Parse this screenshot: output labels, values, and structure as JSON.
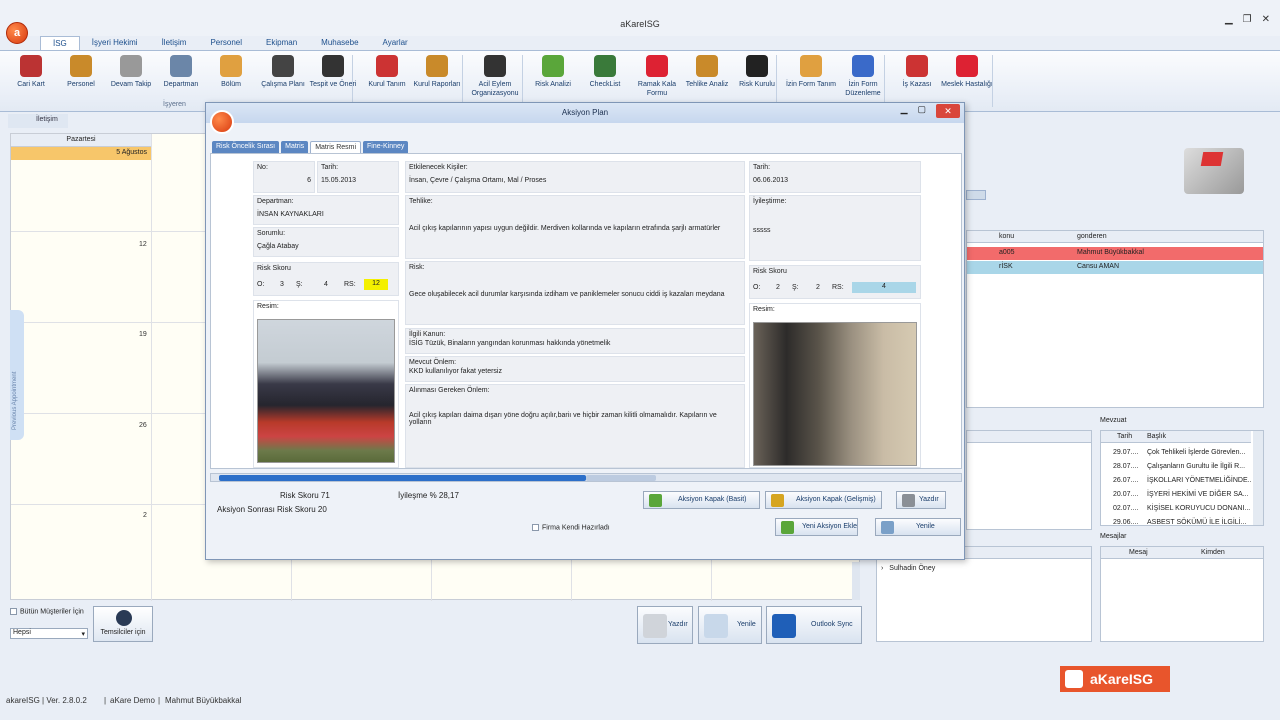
{
  "app": {
    "title": "aKareISG"
  },
  "ribbon": {
    "tabs": [
      "İSG",
      "İşyeri Hekimi",
      "İletişim",
      "Personel",
      "Ekipman",
      "Muhasebe",
      "Ayarlar"
    ],
    "buttons": [
      {
        "label": "Cari Kart",
        "icon": "person-icon",
        "color": "#b33"
      },
      {
        "label": "Personel",
        "icon": "person-icon",
        "color": "#c98a2a"
      },
      {
        "label": "Devam Takip",
        "icon": "clock-icon",
        "color": "#999"
      },
      {
        "label": "Departman",
        "icon": "building-icon",
        "color": "#6b86a8"
      },
      {
        "label": "Bölüm",
        "icon": "list-icon",
        "color": "#e0a040"
      },
      {
        "label": "Çalışma Planı",
        "icon": "clock-icon",
        "color": "#444"
      },
      {
        "label": "Tespit ve Öneri",
        "icon": "pen-icon",
        "color": "#333"
      },
      {
        "label": "Kurul Tanım",
        "icon": "org-chart-icon",
        "color": "#c33"
      },
      {
        "label": "Kurul Raporları",
        "icon": "report-icon",
        "color": "#c98a2a"
      },
      {
        "label": "Acil Eylem Organizasyonu",
        "icon": "people-icon",
        "color": "#333"
      },
      {
        "label": "Risk Analizi",
        "icon": "shield-icon",
        "color": "#5aa63a"
      },
      {
        "label": "CheckList",
        "icon": "checklist-icon",
        "color": "#3a7a3a"
      },
      {
        "label": "Ramak Kala Formu",
        "icon": "stop-icon",
        "color": "#d23"
      },
      {
        "label": "Tehlike Analiz",
        "icon": "document-icon",
        "color": "#c98a2a"
      },
      {
        "label": "Risk Kurulu",
        "icon": "people-icon",
        "color": "#222"
      },
      {
        "label": "İzin Form Tanım",
        "icon": "form-icon",
        "color": "#e0a040"
      },
      {
        "label": "İzin Form Düzenleme",
        "icon": "person-icon",
        "color": "#3a6ac9"
      },
      {
        "label": "İş Kazası",
        "icon": "accident-icon",
        "color": "#c33"
      },
      {
        "label": "Meslek Hastalığı",
        "icon": "heart-icon",
        "color": "#d23"
      }
    ],
    "group_label": "İşyeren"
  },
  "calendar": {
    "tab_label": "İletişim",
    "day_header": "Pazartesi",
    "first_day": "5 Ağustos",
    "week_numbers": [
      "12",
      "19",
      "26",
      "2"
    ],
    "prev_appointment": "Previous Appointment"
  },
  "left_bottom": {
    "all_customers": "Bütün Müşteriler İçin",
    "filter_value": "Hepsi",
    "representatives": "Temsilciler için"
  },
  "bottom_buttons": [
    {
      "label": "Yazdır",
      "icon": "printer-icon"
    },
    {
      "label": "Yenile",
      "icon": "refresh-icon"
    },
    {
      "label": "Outlook Sync",
      "icon": "outlook-icon"
    }
  ],
  "right_grid": {
    "col1": "konu",
    "col2": "gonderen",
    "rows": [
      {
        "konu": "a005",
        "gonderen": "Mahmut Büyükbakkal",
        "color": "#f26b6b"
      },
      {
        "konu": "rİSK",
        "gonderen": "Cansu AMAN",
        "color": "#a9d6e8"
      }
    ]
  },
  "mevzuat": {
    "title": "Mevzuat",
    "col_date": "Tarih",
    "col_title": "Başlık",
    "rows": [
      {
        "date": "29.07....",
        "title": "Çok Tehlikeli İşlerde Görevlen..."
      },
      {
        "date": "28.07....",
        "title": "Çalışanların Gurultu ile İlgili R..."
      },
      {
        "date": "26.07....",
        "title": "İŞKOLLARI YÖNETMELİĞİNDE..."
      },
      {
        "date": "20.07....",
        "title": "İŞYERİ HEKİMİ VE DİĞER SA..."
      },
      {
        "date": "02.07....",
        "title": "KİŞİSEL KORUYUCU DONANI..."
      },
      {
        "date": "29.06....",
        "title": "ASBEST SÖKÜMÜ İLE İLGİLİ..."
      }
    ]
  },
  "mesajlar": {
    "title": "Mesajlar",
    "col_msg": "Mesaj",
    "col_from": "Kimden"
  },
  "tree_item": "Sulhadin Öney",
  "status": {
    "app_version": "akareISG | Ver. 2.8.0.2",
    "company": "aKare Demo",
    "user": "Mahmut Büyükbakkal",
    "brand": "aKareISG"
  },
  "dialog": {
    "title": "Aksiyon Plan",
    "tabs": [
      "Risk Öncelik Sırası",
      "Matris",
      "Matris Resmi",
      "Fine-Kinney"
    ],
    "active_tab": 2,
    "no_label": "No:",
    "no_value": "6",
    "date_label": "Tarih:",
    "date_value": "15.05.2013",
    "dept_label": "Departman:",
    "dept_value": "İNSAN KAYNAKLARI",
    "resp_label": "Sorumlu:",
    "resp_value": "Çağla Atabay",
    "risk_score_label": "Risk Skoru",
    "o_label": "O:",
    "o_value": "3",
    "s_label": "Ş:",
    "s_value": "4",
    "rs_label": "RS:",
    "rs_value": "12",
    "image_label": "Resim:",
    "affected_label": "Etkilenecek Kişiler:",
    "affected_value": "İnsan, Çevre / Çalışma Ortamı, Mal / Proses",
    "hazard_label": "Tehlike:",
    "hazard_value": "Acil çıkış kapılarının yapısı uygun değildir. Merdiven kollarında ve kapıların etrafında şarjlı armatürler",
    "risk_label": "Risk:",
    "risk_value": "Gece oluşabilecek acil durumlar karşısında izdiham ve paniklemeler sonucu ciddi iş kazaları meydana",
    "law_label": "İlgili Kanun:",
    "law_value": "İSİG Tüzük, Binaların yangından korunması hakkında yönetmelik",
    "current_label": "Mevcut Önlem:",
    "current_value": "KKD kullanılıyor fakat yetersiz",
    "required_label": "Alınması Gereken Önlem:",
    "required_value": "Acil çıkış kapıları daima dışarı yöne doğru açılır,bariı ve hiçbir zaman kilitli olmamalıdır. Kapıların ve yolların",
    "r_date_label": "Tarih:",
    "r_date_value": "06.06.2013",
    "improve_label": "İyileştirme:",
    "improve_value": "sssss",
    "r_risk_label": "Risk Skoru",
    "r_o_value": "2",
    "r_s_value": "2",
    "r_rs_value": "4",
    "r_image_label": "Resim:",
    "summary_risk": "Risk Skoru  71",
    "summary_after": "Aksiyon Sonrası Risk Skoru  20",
    "improvement": "İyileşme % 28,17",
    "firm_prepared": "Firma Kendi Hazırladı",
    "btn_cover_basic": "Aksiyon Kapak (Basit)",
    "btn_cover_adv": "Aksiyon Kapak (Gelişmiş)",
    "btn_print": "Yazdır",
    "btn_new": "Yeni Aksiyon Ekle",
    "btn_refresh": "Yenile"
  }
}
